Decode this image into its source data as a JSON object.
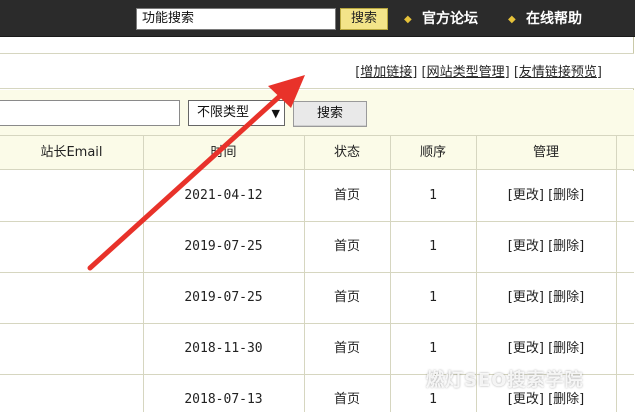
{
  "topbar": {
    "search_value": "功能搜索",
    "search_button": "搜索",
    "forum_link": "官方论坛",
    "help_link": "在线帮助"
  },
  "actions": {
    "add_link": "增加链接",
    "site_type_manage": "网站类型管理",
    "link_preview": "友情链接预览"
  },
  "filter": {
    "keyword_value": "",
    "type_select": "不限类型",
    "search_button": "搜索"
  },
  "table": {
    "columns": [
      "站长Email",
      "时间",
      "状态",
      "顺序",
      "管理"
    ],
    "rows": [
      {
        "email": "",
        "date": "2021-04-12",
        "status": "首页",
        "order": "1",
        "edit": "[更改]",
        "delete": "[删除]"
      },
      {
        "email": "",
        "date": "2019-07-25",
        "status": "首页",
        "order": "1",
        "edit": "[更改]",
        "delete": "[删除]"
      },
      {
        "email": "",
        "date": "2019-07-25",
        "status": "首页",
        "order": "1",
        "edit": "[更改]",
        "delete": "[删除]"
      },
      {
        "email": "",
        "date": "2018-11-30",
        "status": "首页",
        "order": "1",
        "edit": "[更改]",
        "delete": "[删除]"
      },
      {
        "email": "",
        "date": "2018-07-13",
        "status": "首页",
        "order": "1",
        "edit": "[更改]",
        "delete": "[删除]"
      }
    ]
  },
  "watermark": "燃灯SEO搜索学院",
  "colors": {
    "topbar_bg": "#2b2b2b",
    "header_bg": "#fbfbe8",
    "search_button_bg": "#f3e489",
    "arrow": "#e8322a"
  }
}
